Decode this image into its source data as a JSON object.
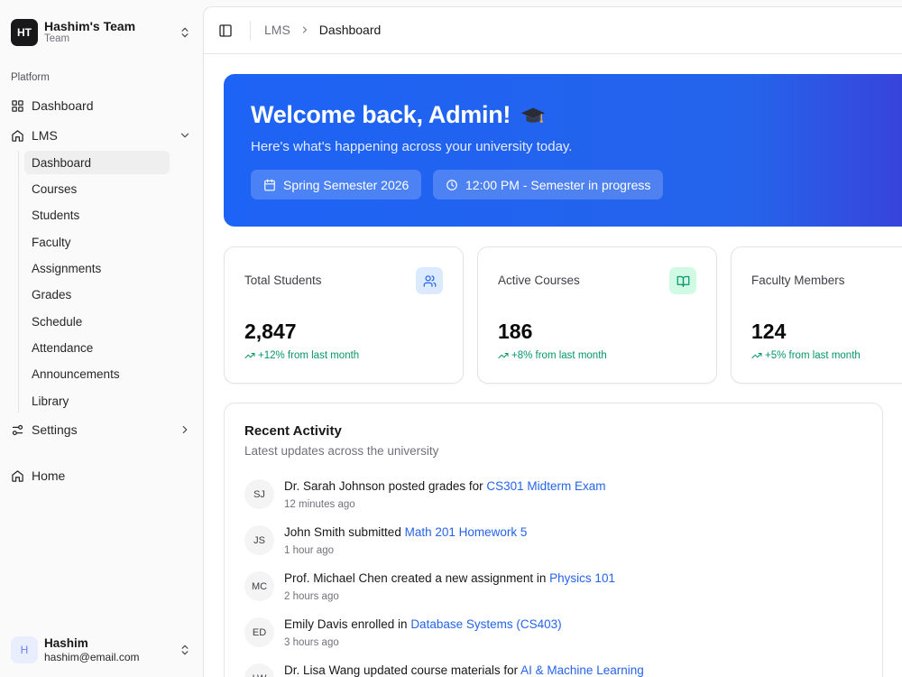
{
  "team": {
    "initials": "HT",
    "name": "Hashim's Team",
    "subtitle": "Team"
  },
  "sidebar": {
    "group_label": "Platform",
    "dashboard": "Dashboard",
    "lms": "LMS",
    "lms_items": [
      "Dashboard",
      "Courses",
      "Students",
      "Faculty",
      "Assignments",
      "Grades",
      "Schedule",
      "Attendance",
      "Announcements",
      "Library"
    ],
    "active_index": 0,
    "settings": "Settings",
    "home": "Home"
  },
  "user": {
    "initial": "H",
    "name": "Hashim",
    "email": "hashim@email.com"
  },
  "breadcrumb": {
    "parent": "LMS",
    "current": "Dashboard"
  },
  "hero": {
    "title": "Welcome back, Admin!",
    "subtitle": "Here's what's happening across your university today.",
    "semester": "Spring Semester 2026",
    "time_status": "12:00 PM - Semester in progress"
  },
  "stats": [
    {
      "title": "Total Students",
      "value": "2,847",
      "trend": "+12% from last month",
      "icon": "users-icon",
      "icon_bg": "#dbeafe",
      "icon_color": "#2563eb"
    },
    {
      "title": "Active Courses",
      "value": "186",
      "trend": "+8% from last month",
      "icon": "book-open-icon",
      "icon_bg": "#d1fae5",
      "icon_color": "#059669"
    },
    {
      "title": "Faculty Members",
      "value": "124",
      "trend": "+5% from last month",
      "icon": "",
      "icon_bg": "",
      "icon_color": ""
    }
  ],
  "activity": {
    "title": "Recent Activity",
    "subtitle": "Latest updates across the university",
    "items": [
      {
        "initials": "SJ",
        "who": "Dr. Sarah Johnson",
        "action": " posted grades for ",
        "target": "CS301 Midterm Exam",
        "time": "12 minutes ago"
      },
      {
        "initials": "JS",
        "who": "John Smith",
        "action": " submitted ",
        "target": "Math 201 Homework 5",
        "time": "1 hour ago"
      },
      {
        "initials": "MC",
        "who": "Prof. Michael Chen",
        "action": " created a new assignment in ",
        "target": "Physics 101",
        "time": "2 hours ago"
      },
      {
        "initials": "ED",
        "who": "Emily Davis",
        "action": " enrolled in ",
        "target": "Database Systems (CS403)",
        "time": "3 hours ago"
      },
      {
        "initials": "LW",
        "who": "Dr. Lisa Wang",
        "action": " updated course materials for ",
        "target": "AI & Machine Learning",
        "time": ""
      }
    ]
  }
}
